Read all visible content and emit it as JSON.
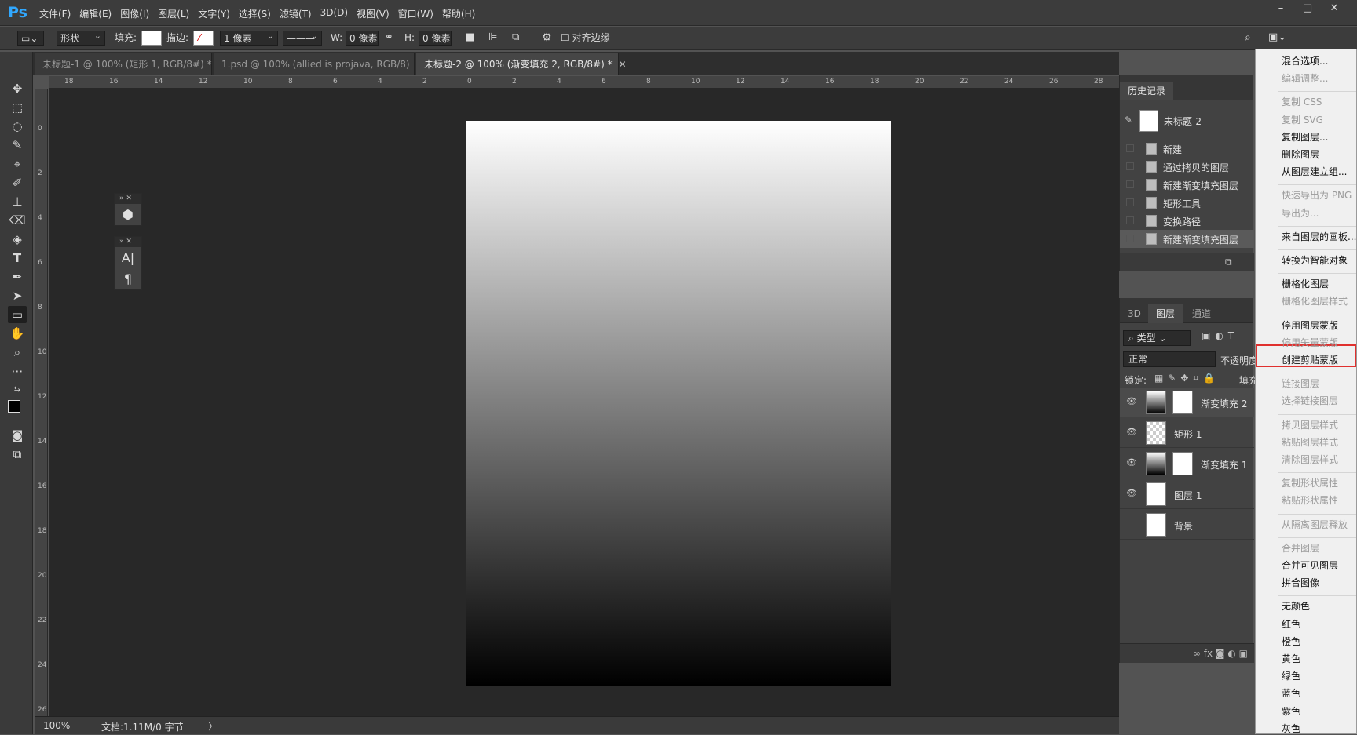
{
  "app": {
    "logo": "Ps"
  },
  "menubar": {
    "items": [
      "文件(F)",
      "编辑(E)",
      "图像(I)",
      "图层(L)",
      "文字(Y)",
      "选择(S)",
      "滤镜(T)",
      "3D(D)",
      "视图(V)",
      "窗口(W)",
      "帮助(H)"
    ]
  },
  "window_controls": [
    "–",
    "□",
    "✕"
  ],
  "options": {
    "mode": "形状",
    "fill_label": "填充:",
    "stroke_label": "描边:",
    "stroke_width": "1 像素",
    "w_label": "W:",
    "w_value": "0 像素",
    "h_label": "H:",
    "h_value": "0 像素",
    "align_edges": "对齐边缘"
  },
  "tabs": [
    {
      "label": "未标题-1 @ 100% (矩形 1, RGB/8#) *",
      "close": "✕"
    },
    {
      "label": "1.psd @ 100% (allied is projava, RGB/8)",
      "close": "✕"
    },
    {
      "label": "未标题-2 @ 100% (渐变填充 2, RGB/8#) *",
      "close": "✕"
    }
  ],
  "ruler": {
    "h": [
      "18",
      "16",
      "14",
      "12",
      "10",
      "8",
      "6",
      "4",
      "2",
      "0",
      "2",
      "4",
      "6",
      "8",
      "10",
      "12",
      "14",
      "16",
      "18",
      "20",
      "22",
      "24",
      "26",
      "28"
    ],
    "v": [
      "0",
      "2",
      "4",
      "6",
      "8",
      "10",
      "12",
      "14",
      "16",
      "18",
      "20",
      "22",
      "24",
      "26"
    ]
  },
  "status": {
    "zoom": "100%",
    "doc": "文档:1.11M/0 字节",
    "arrow": "〉"
  },
  "float_panel": {
    "char_icon": "A|",
    "para_icon": "¶"
  },
  "history": {
    "tab": "历史记录",
    "snapshot": "未标题-2",
    "items": [
      "新建",
      "通过拷贝的图层",
      "新建渐变填充图层",
      "矩形工具",
      "变换路径",
      "新建渐变填充图层"
    ]
  },
  "layers": {
    "tabs": [
      "3D",
      "图层",
      "通道"
    ],
    "filter": "类型",
    "blend": "正常",
    "opacity_label": "不透明度",
    "lock_label": "锁定:",
    "fill_label": "填充",
    "rows": [
      "渐变填充 2",
      "矩形 1",
      "渐变填充 1",
      "图层 1",
      "背景"
    ],
    "footer": "∞  fx  ◙  ◐  ▣"
  },
  "context_menu": [
    {
      "label": "混合选项...",
      "enabled": true
    },
    {
      "label": "编辑调整...",
      "enabled": false
    },
    {
      "sep": true
    },
    {
      "label": "复制 CSS",
      "enabled": false
    },
    {
      "label": "复制 SVG",
      "enabled": false
    },
    {
      "label": "复制图层...",
      "enabled": true
    },
    {
      "label": "删除图层",
      "enabled": true
    },
    {
      "label": "从图层建立组...",
      "enabled": true
    },
    {
      "sep": true
    },
    {
      "label": "快速导出为 PNG",
      "enabled": false
    },
    {
      "label": "导出为...",
      "enabled": false
    },
    {
      "sep": true
    },
    {
      "label": "来自图层的画板...",
      "enabled": true
    },
    {
      "sep": true
    },
    {
      "label": "转换为智能对象",
      "enabled": true
    },
    {
      "sep": true
    },
    {
      "label": "栅格化图层",
      "enabled": true
    },
    {
      "label": "栅格化图层样式",
      "enabled": false
    },
    {
      "sep": true
    },
    {
      "label": "停用图层蒙版",
      "enabled": true
    },
    {
      "label": "停用矢量蒙版",
      "enabled": false
    },
    {
      "label": "创建剪贴蒙版",
      "enabled": true
    },
    {
      "sep": true
    },
    {
      "label": "链接图层",
      "enabled": false
    },
    {
      "label": "选择链接图层",
      "enabled": false
    },
    {
      "sep": true
    },
    {
      "label": "拷贝图层样式",
      "enabled": false
    },
    {
      "label": "粘贴图层样式",
      "enabled": false
    },
    {
      "label": "清除图层样式",
      "enabled": false
    },
    {
      "sep": true
    },
    {
      "label": "复制形状属性",
      "enabled": false
    },
    {
      "label": "粘贴形状属性",
      "enabled": false
    },
    {
      "sep": true
    },
    {
      "label": "从隔离图层释放",
      "enabled": false
    },
    {
      "sep": true
    },
    {
      "label": "合并图层",
      "enabled": false
    },
    {
      "label": "合并可见图层",
      "enabled": true
    },
    {
      "label": "拼合图像",
      "enabled": true
    },
    {
      "sep": true
    },
    {
      "label": "无颜色",
      "enabled": true
    },
    {
      "label": "红色",
      "enabled": true
    },
    {
      "label": "橙色",
      "enabled": true
    },
    {
      "label": "黄色",
      "enabled": true
    },
    {
      "label": "绿色",
      "enabled": true
    },
    {
      "label": "蓝色",
      "enabled": true
    },
    {
      "label": "紫色",
      "enabled": true
    },
    {
      "label": "灰色",
      "enabled": true
    }
  ],
  "highlighted_item": "创建剪贴蒙版"
}
